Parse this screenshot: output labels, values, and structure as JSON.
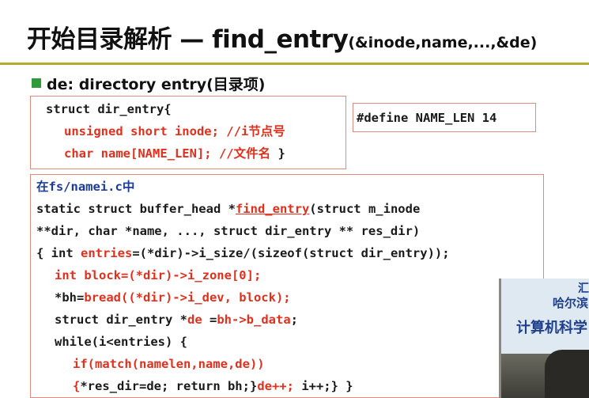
{
  "title": {
    "main": "开始目录解析 — find_entry",
    "suffix": "(&inode,name,...,&de)"
  },
  "subheading": "de:  directory entry(目录项)",
  "struct_box": {
    "l1": "struct dir_entry{",
    "l2_kw": "unsigned short inode; //i节点号",
    "l3_kw": "char name[NAME_LEN]; //文件名",
    "l3_end": " }"
  },
  "define_box": "#define NAME_LEN 14",
  "code": {
    "file_label": "在fs/namei.c中",
    "l1_a": "static struct buffer_head *",
    "l1_fn": "find_entry",
    "l1_b": "(struct m_inode",
    "l2": "**dir, char *name, ..., struct dir_entry ** res_dir)",
    "l3_a": "{ int ",
    "l3_r": "entries",
    "l3_b": "=(*dir)->i_size/(sizeof(struct dir_entry));",
    "l4": "int block=(*dir)->i_zone[0];",
    "l5_a": "*bh=",
    "l5_r": "bread((*dir)->i_dev, block);",
    "l6_a": "struct dir_entry *",
    "l6_r1": "de",
    "l6_b": " =",
    "l6_r2": "bh->b_data",
    "l6_c": ";",
    "l7": "while(i<entries) {",
    "l8": "if(match(namelen,name,de))",
    "l9_r1": "{",
    "l9_a": "*res_dir=de; return bh;}",
    "l9_r2": "de++;",
    "l9_b": " i++;} }"
  },
  "webcam": {
    "sign_top": "汇",
    "sign_line1": "哈尔滨",
    "sign_line2": "计算机科学"
  },
  "colors": {
    "keyword_red": "#e0301e",
    "label_blue": "#1b3c9c",
    "rule_olive": "#b5ac2a",
    "bullet_green": "#2e9a3a",
    "box_border": "#e08a80"
  }
}
